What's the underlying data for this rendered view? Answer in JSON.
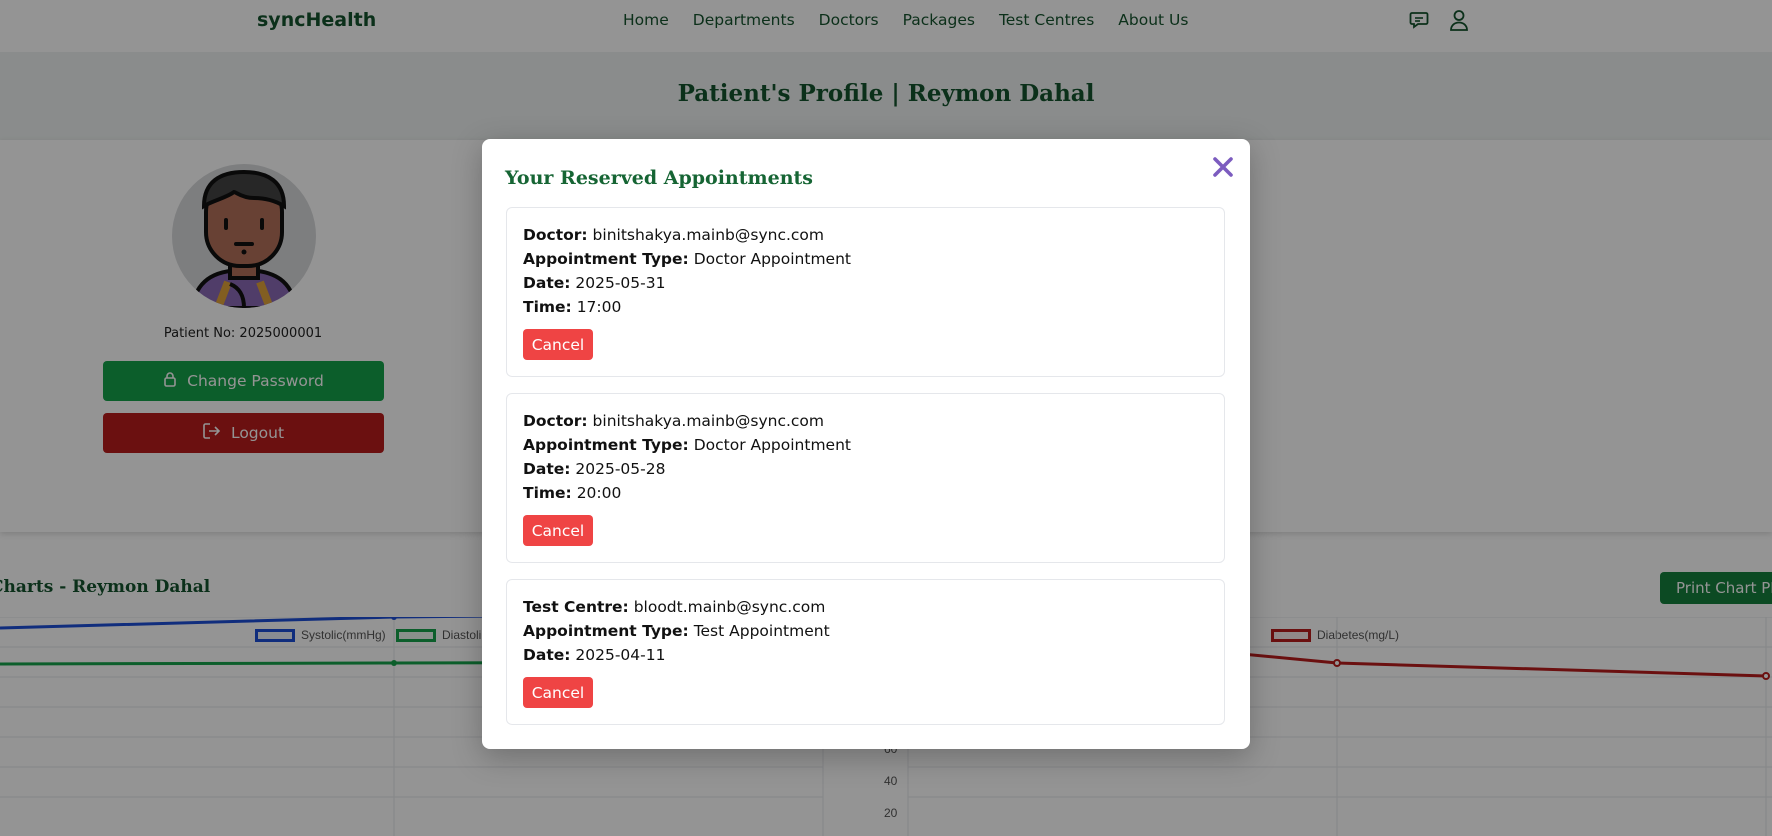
{
  "nav": {
    "brand": "syncHealth",
    "links": [
      "Home",
      "Departments",
      "Doctors",
      "Packages",
      "Test Centres",
      "About Us"
    ],
    "icons": [
      "chat-icon",
      "user-icon"
    ]
  },
  "profile": {
    "title": "Patient's Profile | Reymon Dahal",
    "patient_no": "Patient No: 2025000001",
    "change_password": "Change Password",
    "logout": "Logout"
  },
  "charts": {
    "title": "Charts - Reymon Dahal",
    "print_button": "Print Chart PDF",
    "legend_left": [
      "Systolic(mmHg)",
      "Diastoli"
    ],
    "legend_right": [
      "Diabetes(mg/L)"
    ],
    "y_ticks_right": [
      "60",
      "40",
      "20"
    ],
    "colors": {
      "systolic": "#1d4ed8",
      "diastolic": "#16a34a",
      "diabetes": "#b91c1c"
    }
  },
  "modal": {
    "title": "Your Reserved Appointments",
    "close_icon": "close-icon",
    "appointments": [
      {
        "party_label": "Doctor:",
        "party": "binitshakya.mainb@sync.com",
        "type_label": "Appointment Type:",
        "type": "Doctor Appointment",
        "date_label": "Date:",
        "date": "2025-05-31",
        "time_label": "Time:",
        "time": "17:00",
        "cancel": "Cancel"
      },
      {
        "party_label": "Doctor:",
        "party": "binitshakya.mainb@sync.com",
        "type_label": "Appointment Type:",
        "type": "Doctor Appointment",
        "date_label": "Date:",
        "date": "2025-05-28",
        "time_label": "Time:",
        "time": "20:00",
        "cancel": "Cancel"
      },
      {
        "party_label": "Test Centre:",
        "party": "bloodt.mainb@sync.com",
        "type_label": "Appointment Type:",
        "type": "Test Appointment",
        "date_label": "Date:",
        "date": "2025-04-11",
        "cancel": "Cancel"
      }
    ]
  }
}
